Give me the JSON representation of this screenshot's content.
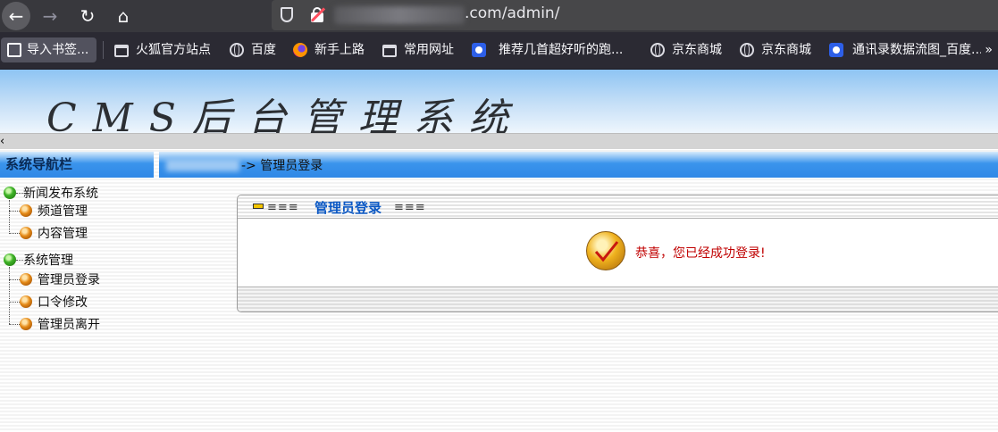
{
  "browser": {
    "url_visible": ".com/admin/",
    "bookmarks": [
      {
        "label": "导入书签...",
        "icon": "import-icon"
      },
      {
        "label": "火狐官方站点",
        "icon": "folder-icon"
      },
      {
        "label": "百度",
        "icon": "globe-icon"
      },
      {
        "label": "新手上路",
        "icon": "firefox-icon"
      },
      {
        "label": "常用网址",
        "icon": "folder-icon"
      },
      {
        "label": "推荐几首超好听的跑...",
        "icon": "baidu-icon"
      },
      {
        "label": "京东商城",
        "icon": "globe-icon"
      },
      {
        "label": "京东商城",
        "icon": "globe-icon"
      },
      {
        "label": "通讯录数据流图_百度...",
        "icon": "baidu-icon"
      }
    ],
    "more": "»"
  },
  "banner": {
    "title": "CMS后台管理系统"
  },
  "nav_header": "系统导航栏",
  "breadcrumb": {
    "arrow": "->",
    "current": "管理员登录"
  },
  "tree": [
    {
      "label": "新闻发布系统",
      "children": [
        "频道管理",
        "内容管理"
      ]
    },
    {
      "label": "系统管理",
      "children": [
        "管理员登录",
        "口令修改",
        "管理员离开"
      ]
    }
  ],
  "panel": {
    "lines": "≡≡≡",
    "title": "管理员登录",
    "message": "恭喜，您已经成功登录!"
  },
  "colors": {
    "accent": "#2f88e6",
    "message": "#c00000",
    "title": "#0b58c4"
  }
}
